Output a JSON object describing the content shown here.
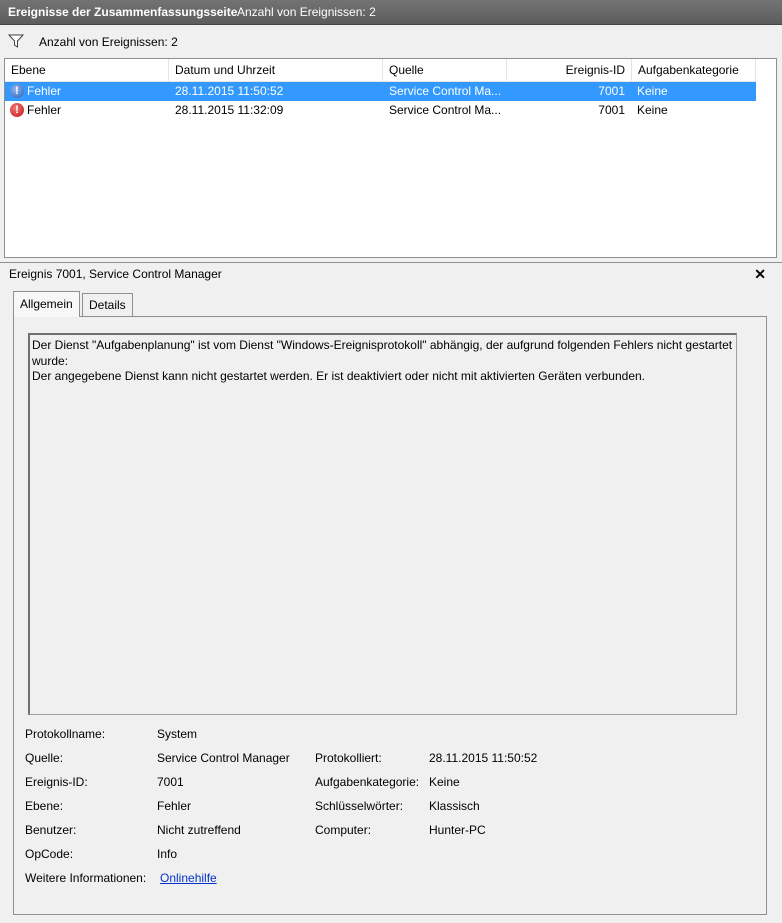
{
  "titlebar": {
    "title": "Ereignisse der Zusammenfassungsseite",
    "count": "Anzahl von Ereignissen: 2"
  },
  "filter": {
    "icon": "filter-icon",
    "text": "Anzahl von Ereignissen: 2"
  },
  "grid": {
    "columns": [
      "Ebene",
      "Datum und Uhrzeit",
      "Quelle",
      "Ereignis-ID",
      "Aufgabenkategorie"
    ],
    "rows": [
      {
        "level": "Fehler",
        "date": "28.11.2015 11:50:52",
        "source": "Service Control Ma...",
        "id": "7001",
        "category": "Keine",
        "selected": true,
        "icon": "error-icon"
      },
      {
        "level": "Fehler",
        "date": "28.11.2015 11:32:09",
        "source": "Service Control Ma...",
        "id": "7001",
        "category": "Keine",
        "selected": false,
        "icon": "error-icon"
      }
    ]
  },
  "detail": {
    "title": "Ereignis 7001, Service Control Manager",
    "close": "✕",
    "tabs": [
      "Allgemein",
      "Details"
    ],
    "message_lines": [
      "Der Dienst \"Aufgabenplanung\" ist vom Dienst \"Windows-Ereignisprotokoll\" abhängig, der aufgrund folgenden Fehlers nicht gestartet",
      "wurde:",
      "Der angegebene Dienst kann nicht gestartet werden. Er ist deaktiviert oder nicht mit aktivierten Geräten verbunden."
    ],
    "props": {
      "protokollname_label": "Protokollname:",
      "protokollname": "System",
      "quelle_label": "Quelle:",
      "quelle": "Service Control Manager",
      "protokolliert_label": "Protokolliert:",
      "protokolliert": "28.11.2015 11:50:52",
      "ereignisid_label": "Ereignis-ID:",
      "ereignisid": "7001",
      "aufgabenkategorie_label": "Aufgabenkategorie:",
      "aufgabenkategorie": "Keine",
      "ebene_label": "Ebene:",
      "ebene": "Fehler",
      "schluesselwoerter_label": "Schlüsselwörter:",
      "schluesselwoerter": "Klassisch",
      "benutzer_label": "Benutzer:",
      "benutzer": "Nicht zutreffend",
      "computer_label": "Computer:",
      "computer": "Hunter-PC",
      "opcode_label": "OpCode:",
      "opcode": "Info",
      "weitere_label": "Weitere Informationen:",
      "weitere_link": "Onlinehilfe"
    }
  },
  "colors": {
    "selection": "#3399ff",
    "titlebar": "#5c5c5c",
    "link": "#0033cc"
  }
}
